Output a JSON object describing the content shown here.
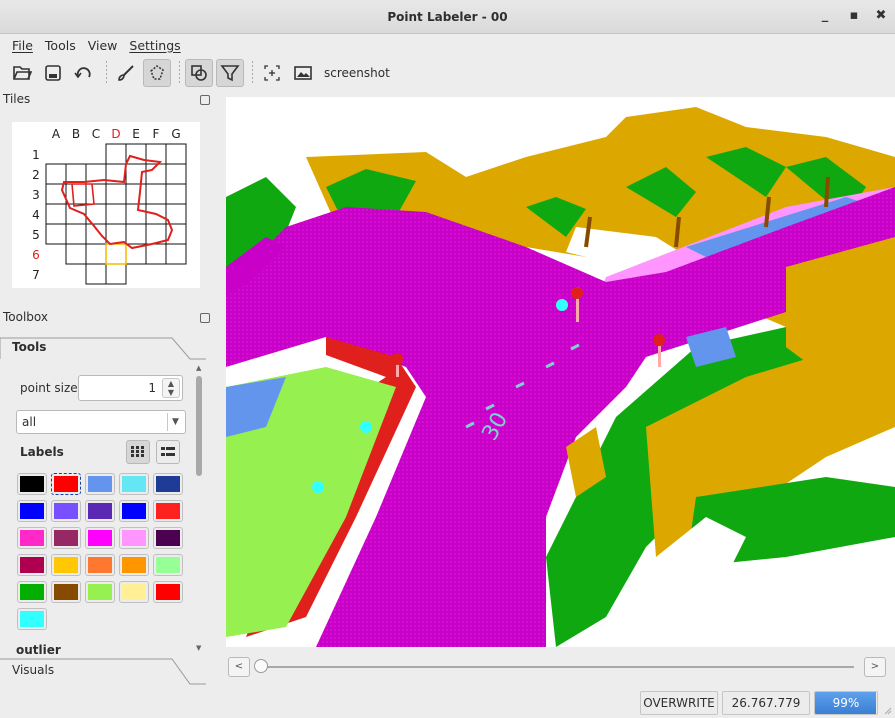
{
  "window": {
    "title": "Point Labeler - 00",
    "minimize": "_",
    "maximize": "▪",
    "close": "✖"
  },
  "menu": {
    "file": "File",
    "tools": "Tools",
    "view": "View",
    "settings": "Settings"
  },
  "toolbar": {
    "icons": [
      "open-folder-icon",
      "save-icon",
      "reload-icon",
      "brush-icon",
      "polygon-icon",
      "polygon-select-icon",
      "filter-icon",
      "crosshair-icon",
      "screenshot-icon"
    ],
    "screenshot_label": "screenshot"
  },
  "tiles": {
    "title": "Tiles",
    "columns": [
      "A",
      "B",
      "C",
      "D",
      "E",
      "F",
      "G"
    ],
    "rows": [
      "1",
      "2",
      "3",
      "4",
      "5",
      "6",
      "7"
    ],
    "highlight_column": "D",
    "highlight_row": "6",
    "highlight_color": "#e0201c"
  },
  "toolbox": {
    "title": "Toolbox",
    "tab_tools": "Tools",
    "point_size_label": "point size",
    "point_size_value": "1",
    "filter_value": "all",
    "labels_heading": "Labels",
    "next_section": "outlier",
    "tab_visuals": "Visuals",
    "label_colors": [
      "#000000",
      "#ff0000",
      "#6495ed",
      "#64e6f5",
      "#1e3c96",
      "#0000ff",
      "#7850ff",
      "#5a28b4",
      "#0000ff",
      "#ff2020",
      "#ff28c8",
      "#962864",
      "#ff00ff",
      "#ff96ff",
      "#4b0050",
      "#af0050",
      "#ffc800",
      "#ff7830",
      "#ff9600",
      "#96ff96",
      "#00af00",
      "#874b00",
      "#96f050",
      "#fff096",
      "#ff0000",
      "#32ffff"
    ],
    "selected_index": 1
  },
  "status": {
    "mode": "OVERWRITE",
    "value": "26.767.779",
    "progress_text": "99%",
    "progress": 0.99
  },
  "colors": {
    "accent": "#3e86d8",
    "road": "#c800c8",
    "building": "#dca800",
    "vegetation": "#10a810",
    "sidewalk": "#ff96ff"
  }
}
